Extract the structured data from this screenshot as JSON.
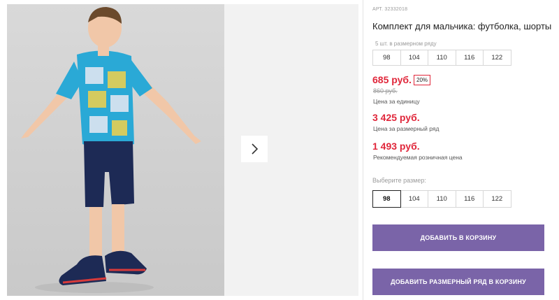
{
  "product": {
    "sku": "АРТ. 32332018",
    "title": "Комплект для мальчика: футболка, шорты",
    "pack_label": "5 шт. в размерном ряду",
    "pack_sizes": [
      "98",
      "104",
      "110",
      "116",
      "122"
    ],
    "price_unit": "685 руб.",
    "discount": "20%",
    "old_price": "860 руб.",
    "price_unit_note": "Цена за единицу",
    "price_pack": "3 425 руб.",
    "price_pack_note": "Цена за размерный ряд",
    "price_retail": "1 493 руб.",
    "price_retail_note": "Рекомендуемая розничная цена",
    "choose_size_label": "Выберите размер:",
    "sizes": [
      "98",
      "104",
      "110",
      "116",
      "122"
    ],
    "selected_size": "98"
  },
  "buttons": {
    "add_to_cart": "ДОБАВИТЬ В КОРЗИНУ",
    "add_pack_to_cart": "ДОБАВИТЬ РАЗМЕРНЫЙ РЯД В КОРЗИНУ"
  },
  "colors": {
    "price_red": "#e0263a",
    "button_purple": "#7a64a8",
    "shirt_blue": "#2aa9d6",
    "shorts_navy": "#1d2a55"
  },
  "icons": {
    "gallery_next": "chevron-right-icon"
  }
}
